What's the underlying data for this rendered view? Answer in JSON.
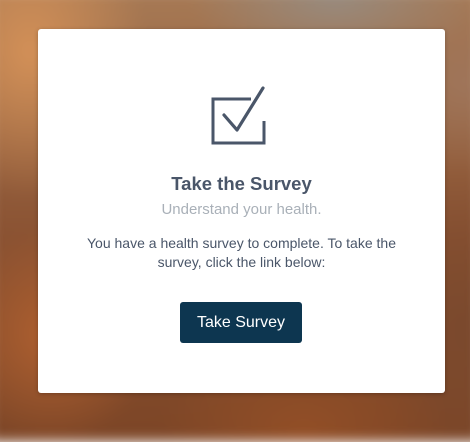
{
  "card": {
    "icon": "checkbox-checked-icon",
    "title": "Take the Survey",
    "subtitle": "Understand your health.",
    "message": "You have a health survey to complete. To take the survey, click the link below:",
    "button_label": "Take Survey"
  },
  "colors": {
    "button_background": "#0d3650",
    "heading_text": "#4a5669",
    "subtitle_text": "#a9b0b8",
    "card_background": "#ffffff"
  }
}
